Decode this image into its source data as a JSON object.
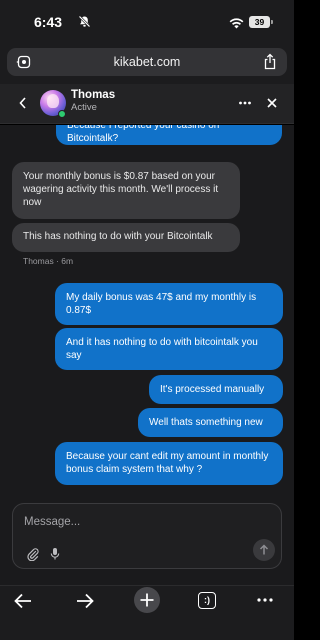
{
  "status_bar": {
    "time": "6:43",
    "battery": "39"
  },
  "browser": {
    "url": "kikabet.com"
  },
  "chat": {
    "agent_name": "Thomas",
    "agent_status": "Active",
    "agent_meta": "Thomas · 6m",
    "messages": [
      {
        "from": "user",
        "text": "Because I reported your casino on Bitcointalk?"
      },
      {
        "from": "agent",
        "text": "Your monthly bonus is $0.87 based on your wagering activity this month. We'll process it now"
      },
      {
        "from": "agent",
        "text": "This has nothing to do with your Bitcointalk"
      },
      {
        "from": "user",
        "text": "My daily bonus was 47$ and my monthly is 0.87$"
      },
      {
        "from": "user",
        "text": "And it has nothing to do with bitcointalk you say"
      },
      {
        "from": "user",
        "text": "It's processed manually"
      },
      {
        "from": "user",
        "text": "Well thats something new"
      },
      {
        "from": "user",
        "text": "Because your cant edit my amount in monthly bonus claim system that why ?"
      }
    ],
    "composer_placeholder": "Message..."
  },
  "toolbar": {
    "tab_count": ":)"
  },
  "colors": {
    "outgoing_bubble": "#1172c9",
    "incoming_bubble": "#3a3a3d",
    "online": "#2ecc71"
  },
  "icons": [
    "silent-bell-icon",
    "wifi-icon",
    "battery-icon",
    "site-settings-icon",
    "share-icon",
    "back-chevron-icon",
    "more-icon",
    "close-icon",
    "attach-icon",
    "mic-icon",
    "send-arrow-icon",
    "back-arrow-icon",
    "forward-arrow-icon",
    "plus-icon",
    "tabs-icon",
    "menu-dots-icon"
  ]
}
